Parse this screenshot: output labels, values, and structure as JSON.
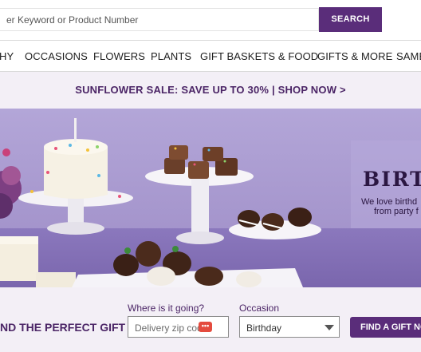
{
  "search": {
    "placeholder": "er Keyword or Product Number",
    "button_label": "SEARCH"
  },
  "nav": {
    "items": [
      {
        "label": "HY"
      },
      {
        "label": "OCCASIONS"
      },
      {
        "label": "FLOWERS"
      },
      {
        "label": "PLANTS"
      },
      {
        "label": "GIFT BASKETS & FOOD"
      },
      {
        "label": "GIFTS & MORE"
      },
      {
        "label": "SAME"
      }
    ]
  },
  "promo": {
    "text": "SUNFLOWER SALE: SAVE UP TO 30% | SHOP NOW >"
  },
  "hero": {
    "title": "BIRTH",
    "subtitle_line1": "We love birthd",
    "subtitle_line2": "from party f"
  },
  "gift_finder": {
    "title": "ND THE PERFECT GIFT",
    "where_label": "Where is it going?",
    "zip_placeholder": "Delivery zip code",
    "occasion_label": "Occasion",
    "occasion_value": "Birthday",
    "button_label": "FIND A GIFT NO"
  },
  "colors": {
    "brand_purple": "#5a2d7a",
    "promo_text": "#4b2566",
    "hero_background": "#a898cf",
    "panel_background": "#f3eff6"
  }
}
